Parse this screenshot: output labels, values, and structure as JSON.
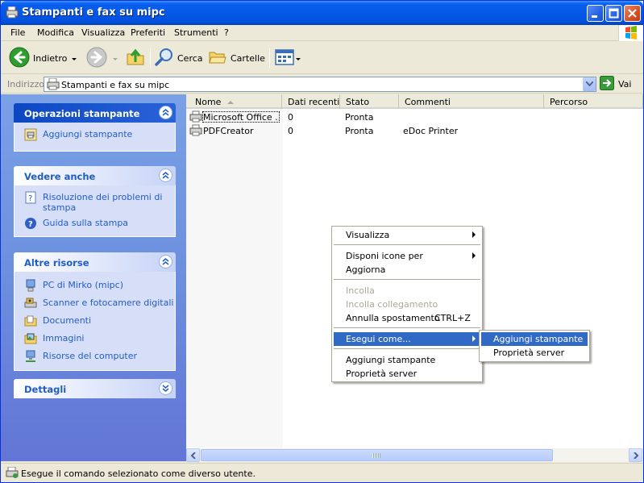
{
  "window": {
    "title": "Stampanti e fax su mipc"
  },
  "menubar": {
    "items": [
      "File",
      "Modifica",
      "Visualizza",
      "Preferiti",
      "Strumenti",
      "?"
    ]
  },
  "toolbar": {
    "back_label": "Indietro",
    "search_label": "Cerca",
    "folders_label": "Cartelle"
  },
  "addressbar": {
    "label": "Indirizzo",
    "value": "Stampanti e fax su mipc",
    "go_label": "Vai"
  },
  "taskpane": {
    "panels": [
      {
        "title": "Operazioni stampante",
        "links": [
          "Aggiungi stampante"
        ]
      },
      {
        "title": "Vedere anche",
        "links": [
          "Risoluzione dei problemi di stampa",
          "Guida sulla stampa"
        ]
      },
      {
        "title": "Altre risorse",
        "links": [
          "PC di Mirko (mipc)",
          "Scanner e fotocamere digitali",
          "Documenti",
          "Immagini",
          "Risorse del computer"
        ]
      },
      {
        "title": "Dettagli",
        "links": []
      }
    ]
  },
  "listview": {
    "columns": [
      "Nome",
      "Dati recenti",
      "Stato",
      "Commenti",
      "Percorso"
    ],
    "rows": [
      {
        "name": "Microsoft Office ...",
        "recent": "0",
        "status": "Pronta",
        "comments": "",
        "path": ""
      },
      {
        "name": "PDFCreator",
        "recent": "0",
        "status": "Pronta",
        "comments": "eDoc Printer",
        "path": ""
      }
    ]
  },
  "context_menu": {
    "items": [
      {
        "label": "Visualizza",
        "submenu": true
      },
      {
        "label": "Disponi icone per",
        "submenu": true
      },
      {
        "label": "Aggiorna"
      },
      {
        "label": "Incolla",
        "disabled": true
      },
      {
        "label": "Incolla collegamento",
        "disabled": true
      },
      {
        "label": "Annulla spostamento",
        "shortcut": "CTRL+Z"
      },
      {
        "label": "Esegui come...",
        "submenu": true,
        "highlighted": true
      },
      {
        "label": "Aggiungi stampante"
      },
      {
        "label": "Proprietà server"
      }
    ]
  },
  "submenu": {
    "items": [
      {
        "label": "Aggiungi stampante",
        "highlighted": true
      },
      {
        "label": "Proprietà server"
      }
    ]
  },
  "statusbar": {
    "text": "Esegue il comando selezionato come diverso utente."
  },
  "colors": {
    "title_blue": "#0558e6",
    "highlight": "#316ac5",
    "link_blue": "#215dc6"
  }
}
